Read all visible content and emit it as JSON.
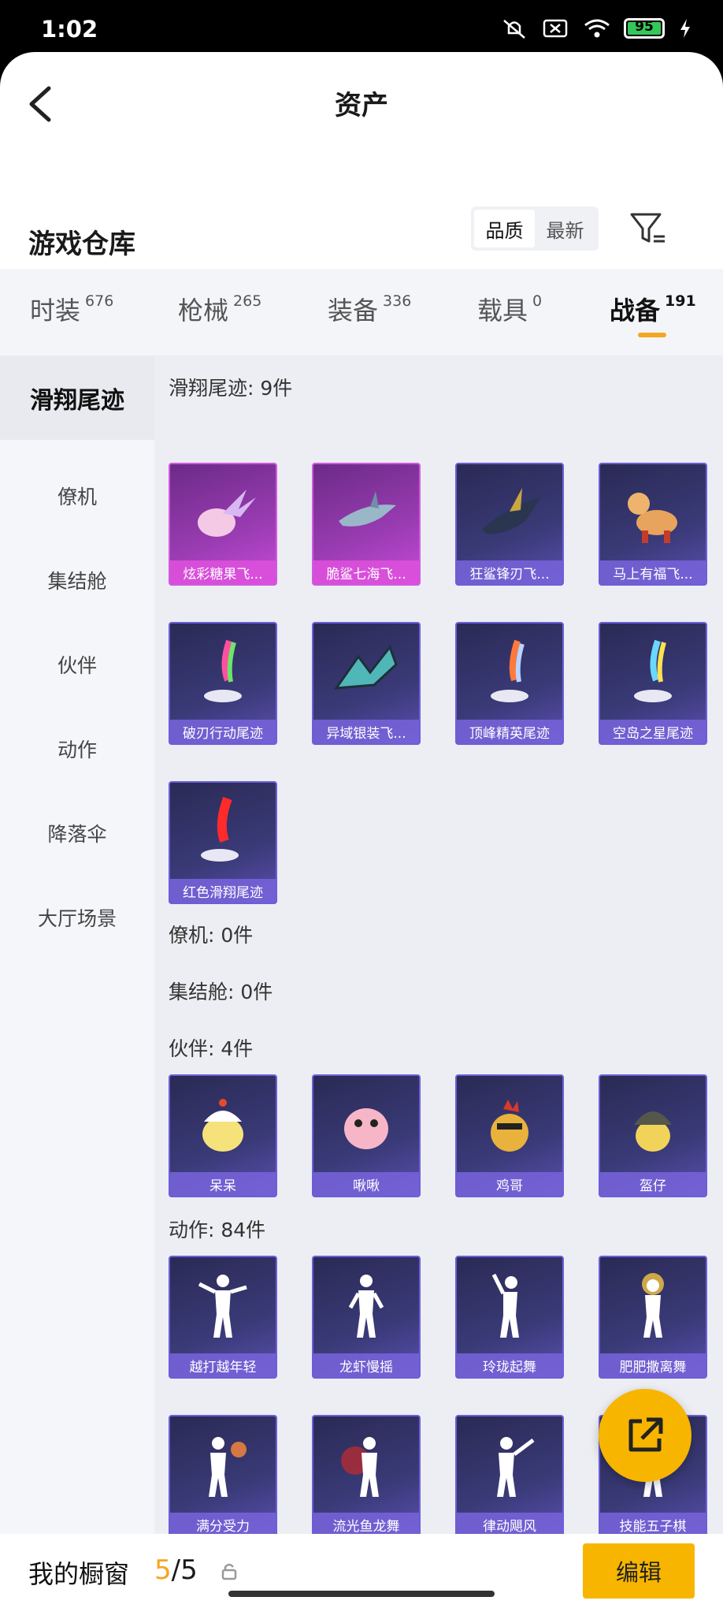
{
  "status": {
    "time": "1:02",
    "battery": "95"
  },
  "header": {
    "title": "资产"
  },
  "warehouse": {
    "title": "游戏仓库",
    "sort_quality": "品质",
    "sort_newest": "最新"
  },
  "tabs": [
    {
      "label": "时装",
      "count": "676"
    },
    {
      "label": "枪械",
      "count": "265"
    },
    {
      "label": "装备",
      "count": "336"
    },
    {
      "label": "载具",
      "count": "0"
    },
    {
      "label": "战备",
      "count": "191"
    }
  ],
  "sidebar": [
    "滑翔尾迹",
    "僚机",
    "集结舱",
    "伙伴",
    "动作",
    "降落伞",
    "大厅场景"
  ],
  "groups": {
    "trail_title": "滑翔尾迹: 9件",
    "wingman_title": "僚机: 0件",
    "capsule_title": "集结舱: 0件",
    "partner_title": "伙伴: 4件",
    "emote_title": "动作: 84件"
  },
  "trail_items": [
    "炫彩糖果飞...",
    "脆鲨七海飞...",
    "狂鲨锋刃飞...",
    "马上有福飞...",
    "破刃行动尾迹",
    "异域银装飞...",
    "顶峰精英尾迹",
    "空岛之星尾迹",
    "红色滑翔尾迹"
  ],
  "partner_items": [
    "呆呆",
    "啾啾",
    "鸡哥",
    "盔仔"
  ],
  "emote_items": [
    "越打越年轻",
    "龙虾慢摇",
    "玲珑起舞",
    "肥肥撒离舞",
    "满分受力",
    "流光鱼龙舞",
    "律动飓风",
    "技能五子棋"
  ],
  "bottom": {
    "window_label": "我的橱窗",
    "window_current": "5",
    "window_total": "/5",
    "edit_label": "编辑"
  }
}
